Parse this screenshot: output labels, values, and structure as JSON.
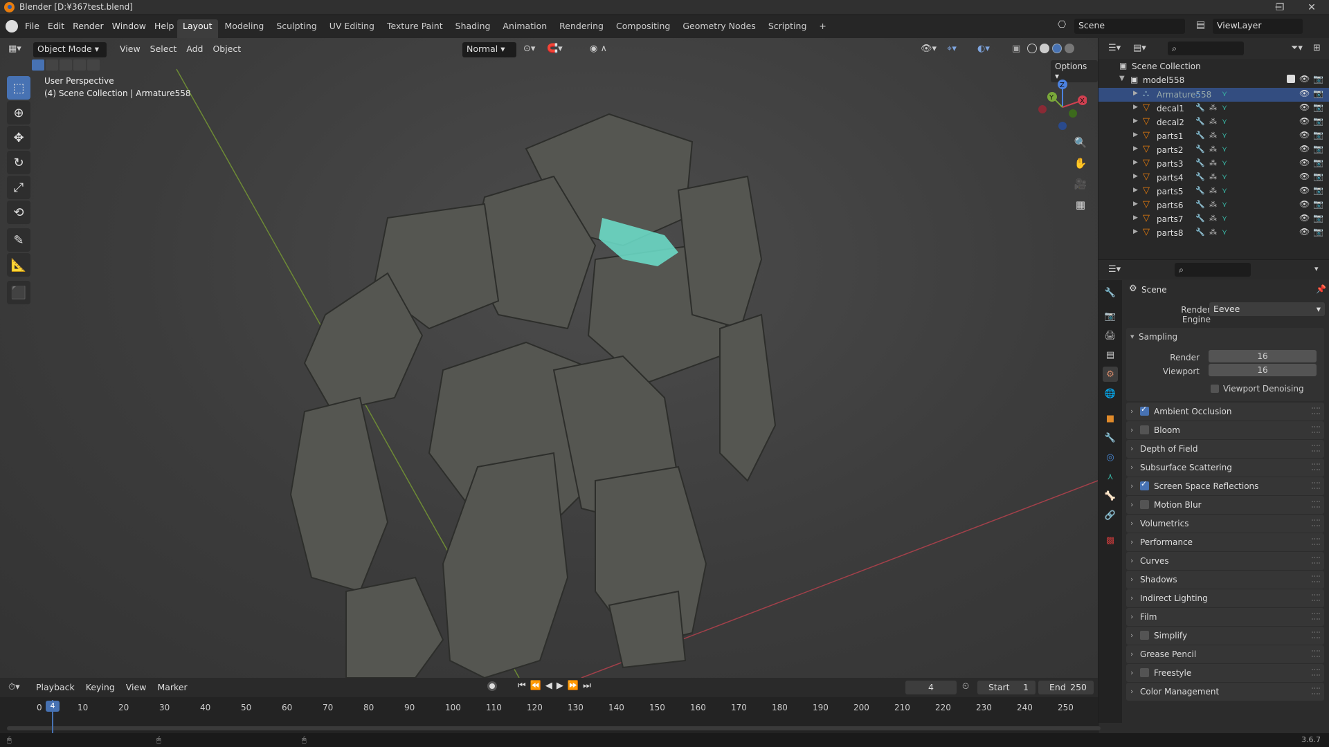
{
  "window": {
    "title": "Blender [D:¥367test.blend]",
    "minimize": "─",
    "maximize": "❐",
    "close": "✕"
  },
  "menubar": {
    "items": [
      "File",
      "Edit",
      "Render",
      "Window",
      "Help"
    ]
  },
  "workspaces": {
    "tabs": [
      "Layout",
      "Modeling",
      "Sculpting",
      "UV Editing",
      "Texture Paint",
      "Shading",
      "Animation",
      "Rendering",
      "Compositing",
      "Geometry Nodes",
      "Scripting"
    ],
    "add": "+",
    "active": "Layout"
  },
  "scene": {
    "label": "Scene",
    "view_layer": "ViewLayer"
  },
  "viewport": {
    "mode": "Object Mode",
    "menus": [
      "View",
      "Select",
      "Add",
      "Object"
    ],
    "orientation": "Normal",
    "options": "Options",
    "overlay_title": "User Perspective",
    "overlay_sub": "(4) Scene Collection | Armature558",
    "gizmo": {
      "x": "X",
      "y": "Y",
      "z": "Z"
    }
  },
  "outliner": {
    "root": "Scene Collection",
    "collection": "model558",
    "items": [
      "Armature558",
      "decal1",
      "decal2",
      "parts1",
      "parts2",
      "parts3",
      "parts4",
      "parts5",
      "parts6",
      "parts7",
      "parts8"
    ],
    "selected": "Armature558"
  },
  "properties": {
    "context": "Scene",
    "render_engine_label": "Render Engine",
    "render_engine": "Eevee",
    "sampling": {
      "title": "Sampling",
      "render_label": "Render",
      "render_value": "16",
      "viewport_label": "Viewport",
      "viewport_value": "16",
      "denoise": "Viewport Denoising"
    },
    "panels": [
      {
        "label": "Ambient Occlusion",
        "checkbox": true,
        "checked": true
      },
      {
        "label": "Bloom",
        "checkbox": true,
        "checked": false
      },
      {
        "label": "Depth of Field",
        "checkbox": false
      },
      {
        "label": "Subsurface Scattering",
        "checkbox": false
      },
      {
        "label": "Screen Space Reflections",
        "checkbox": true,
        "checked": true
      },
      {
        "label": "Motion Blur",
        "checkbox": true,
        "checked": false
      },
      {
        "label": "Volumetrics",
        "checkbox": false
      },
      {
        "label": "Performance",
        "checkbox": false
      },
      {
        "label": "Curves",
        "checkbox": false
      },
      {
        "label": "Shadows",
        "checkbox": false
      },
      {
        "label": "Indirect Lighting",
        "checkbox": false
      },
      {
        "label": "Film",
        "checkbox": false
      },
      {
        "label": "Simplify",
        "checkbox": true,
        "checked": false
      },
      {
        "label": "Grease Pencil",
        "checkbox": false
      },
      {
        "label": "Freestyle",
        "checkbox": true,
        "checked": false
      },
      {
        "label": "Color Management",
        "checkbox": false
      }
    ]
  },
  "timeline": {
    "menus": [
      "Playback",
      "Keying",
      "View",
      "Marker"
    ],
    "current_frame": "4",
    "start_label": "Start",
    "start": "1",
    "end_label": "End",
    "end": "250",
    "ticks": [
      "0",
      "10",
      "20",
      "30",
      "40",
      "50",
      "60",
      "70",
      "80",
      "90",
      "100",
      "110",
      "120",
      "130",
      "140",
      "150",
      "160",
      "170",
      "180",
      "190",
      "200",
      "210",
      "220",
      "230",
      "240",
      "250"
    ]
  },
  "status": {
    "version": "3.6.7"
  },
  "colors": {
    "accent": "#4772b3",
    "selected_row": "#334d80",
    "orange": "#e87d0d"
  }
}
